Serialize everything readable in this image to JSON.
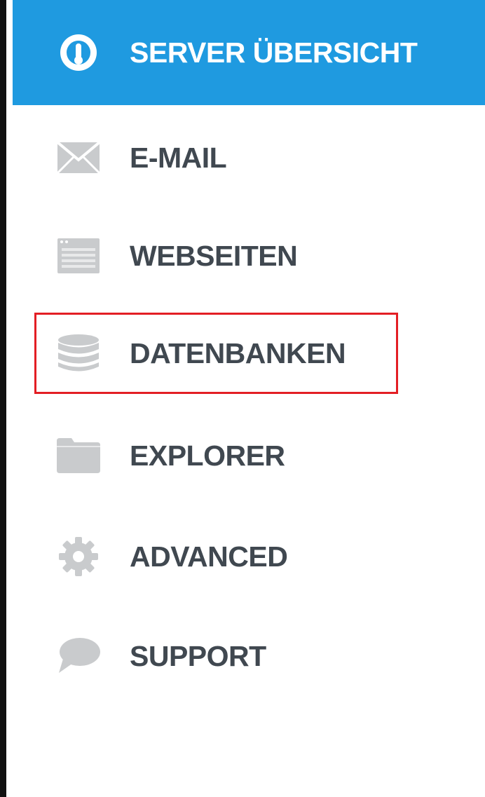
{
  "sidebar": {
    "items": [
      {
        "label": "SERVER ÜBERSICHT",
        "icon": "dashboard-gauge-icon",
        "active": true
      },
      {
        "label": "E-MAIL",
        "icon": "envelope-icon",
        "active": false
      },
      {
        "label": "WEBSEITEN",
        "icon": "browser-window-icon",
        "active": false
      },
      {
        "label": "DATENBANKEN",
        "icon": "database-icon",
        "active": false,
        "highlighted": true
      },
      {
        "label": "EXPLORER",
        "icon": "folder-icon",
        "active": false
      },
      {
        "label": "ADVANCED",
        "icon": "gear-icon",
        "active": false
      },
      {
        "label": "SUPPORT",
        "icon": "speech-bubble-icon",
        "active": false
      }
    ]
  },
  "colors": {
    "active_background": "#1f9ae0",
    "active_text": "#ffffff",
    "text": "#404850",
    "icon_gray": "#c9cbcd",
    "highlight_border": "#e31e24"
  }
}
